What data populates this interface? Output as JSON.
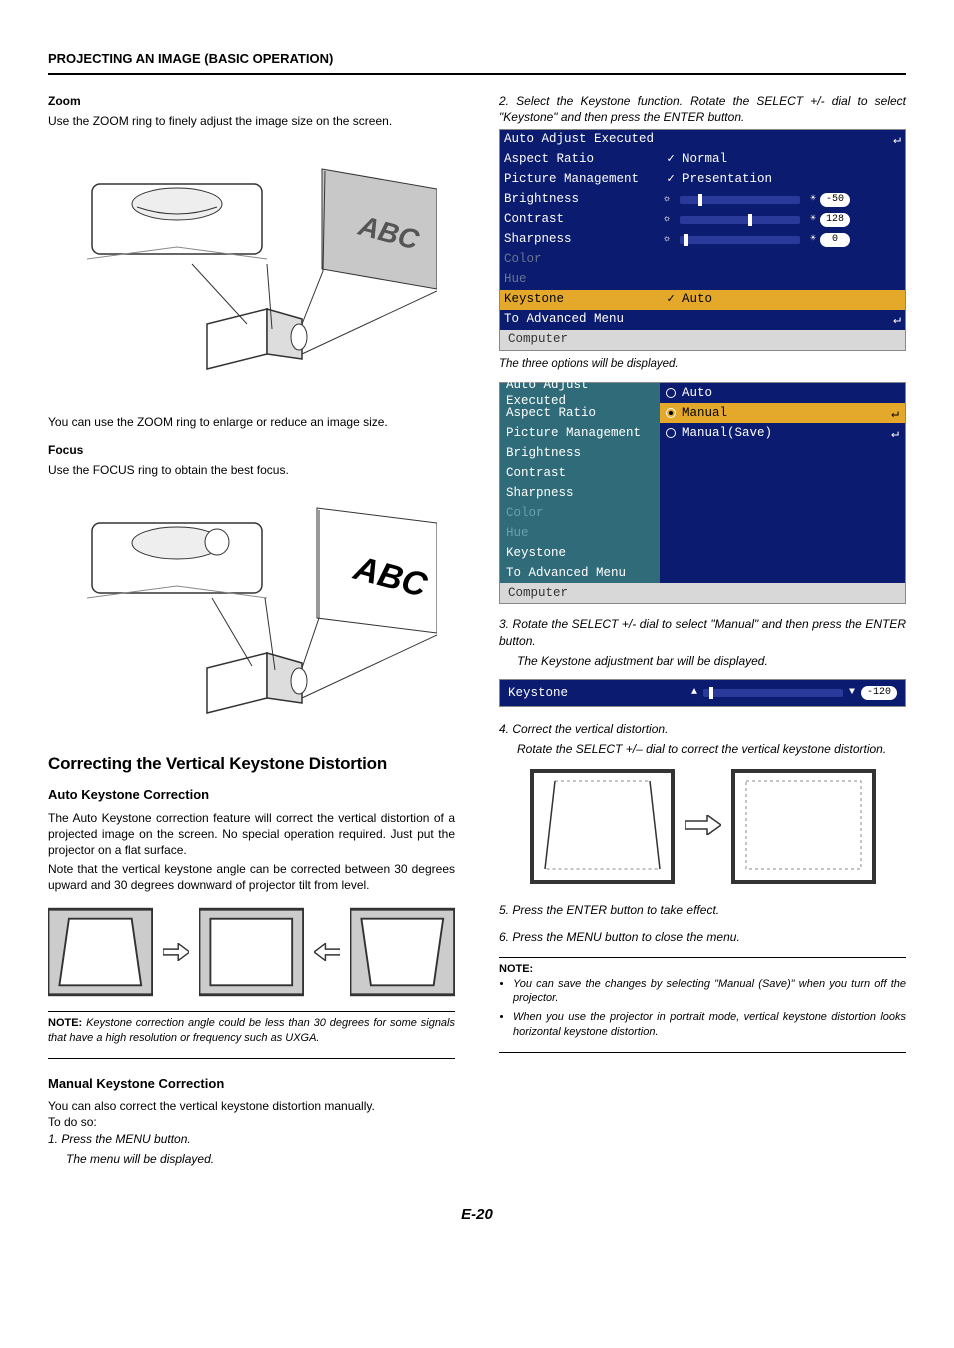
{
  "header": "PROJECTING AN IMAGE (BASIC OPERATION)",
  "left": {
    "zoom_h": "Zoom",
    "zoom_p": "Use the ZOOM ring to finely adjust the image size on the screen.",
    "zoom_caption": "You can use the ZOOM ring to enlarge or reduce an image size.",
    "focus_h": "Focus",
    "focus_p": "Use the FOCUS ring to obtain the best focus.",
    "h2": "Correcting the Vertical Keystone Distortion",
    "auto_h": "Auto Keystone Correction",
    "auto_p1": "The Auto Keystone correction feature will correct the vertical distortion of a projected image on the screen. No special operation required. Just put the projector on a flat surface.",
    "auto_p2": "Note that the vertical keystone angle can be corrected between 30 degrees upward and 30 degrees downward of projector tilt from level.",
    "note1_label": "NOTE:",
    "note1": " Keystone correction angle could be less than 30 degrees for some signals that have a high resolution or frequency such as UXGA.",
    "manual_h": "Manual Keystone Correction",
    "manual_p": "You can also correct the vertical keystone distortion manually.",
    "todo": "To do so:",
    "step1": "1. Press the MENU button.",
    "step1_sub": "The menu will be displayed."
  },
  "right": {
    "step2": "2. Select the Keystone function. Rotate the SELECT +/- dial to select \"Keystone\" and then press the ENTER button.",
    "menu1": {
      "rows": [
        {
          "label": "Auto Adjust Executed",
          "val": "",
          "enter": true
        },
        {
          "label": "Aspect Ratio",
          "val": "Normal",
          "check": true
        },
        {
          "label": "Picture Management",
          "val": "Presentation",
          "check": true
        },
        {
          "label": "Brightness",
          "slider": "s1",
          "num": "-50"
        },
        {
          "label": "Contrast",
          "slider": "s2",
          "num": "128"
        },
        {
          "label": "Sharpness",
          "slider": "s3",
          "num": "0"
        },
        {
          "label": "Color",
          "dim": true
        },
        {
          "label": "Hue",
          "dim": true
        },
        {
          "label": "Keystone",
          "val": "Auto",
          "check": true,
          "hl": true
        },
        {
          "label": "To Advanced Menu",
          "enter": true
        }
      ],
      "footer": "Computer"
    },
    "caption1": "The three options will be displayed.",
    "menu2": {
      "left": [
        "Auto Adjust Executed",
        "Aspect Ratio",
        "Picture Management",
        "Brightness",
        "Contrast",
        "Sharpness",
        "Color",
        "Hue",
        "Keystone",
        "To Advanced Menu"
      ],
      "leftDim": [
        6,
        7
      ],
      "right": [
        {
          "label": "Auto"
        },
        {
          "label": "Manual",
          "hl": true,
          "enter": true,
          "filled": true
        },
        {
          "label": "Manual(Save)",
          "enter": true
        }
      ],
      "footer": "Computer"
    },
    "step3": "3. Rotate the SELECT +/- dial to select \"Manual\" and then press the ENTER button.",
    "step3_sub": "The Keystone adjustment bar will be displayed.",
    "ks_bar": {
      "label": "Keystone",
      "num": "-120"
    },
    "step4": "4. Correct the vertical distortion.",
    "step4_sub": "Rotate the SELECT +/– dial to correct the vertical keystone distortion.",
    "step5": "5. Press the ENTER button to take effect.",
    "step6": "6. Press the MENU button to close the menu.",
    "note2_label": "NOTE:",
    "bullets": [
      "You can save the changes by selecting \"Manual (Save)\" when you turn off the projector.",
      "When you use the projector in portrait mode, vertical keystone distortion looks horizontal keystone distortion."
    ]
  },
  "page_num": "E-20"
}
